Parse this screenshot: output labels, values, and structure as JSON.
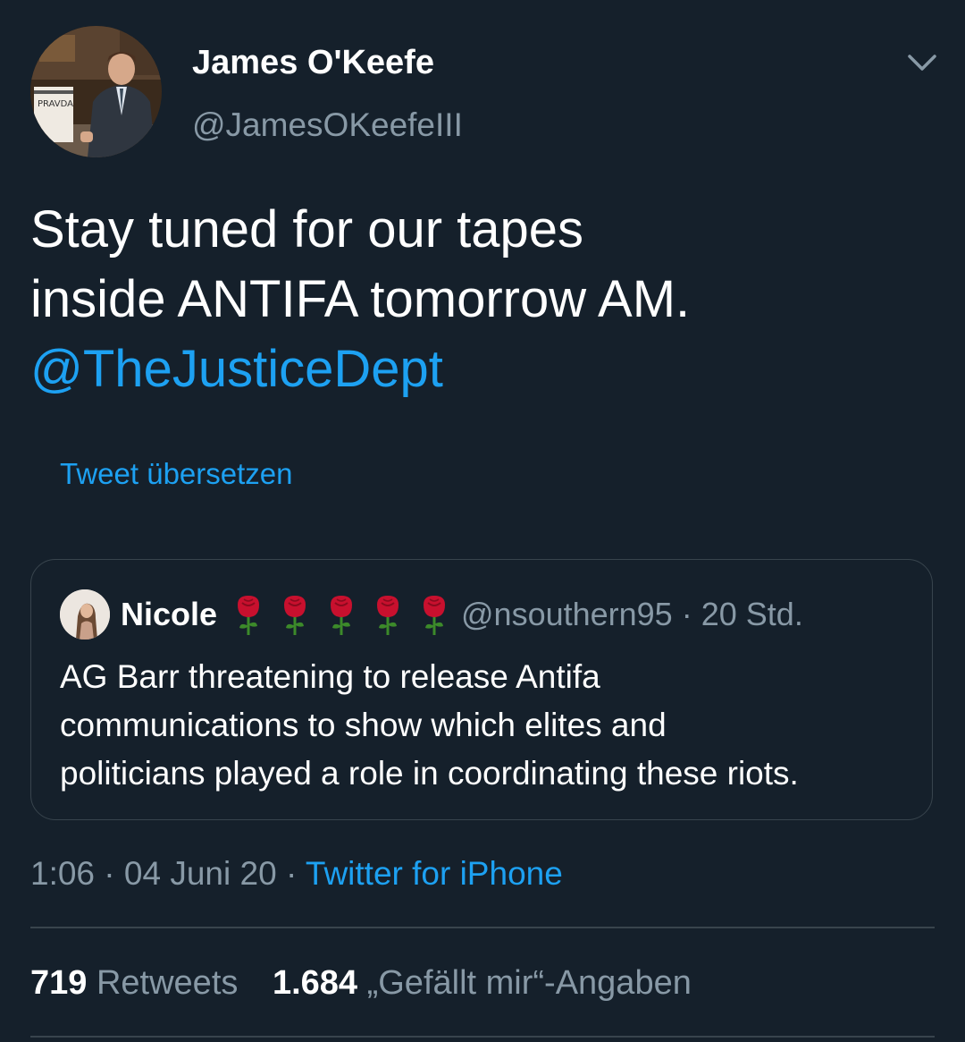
{
  "author": {
    "display_name": "James O'Keefe",
    "handle": "@JamesOKeefeIII",
    "avatar_sign_text": "PRAVDA"
  },
  "tweet": {
    "text_lines": [
      "Stay tuned for our tapes",
      "inside ANTIFA tomorrow AM."
    ],
    "mention": "@TheJusticeDept",
    "translate_label": "Tweet übersetzen"
  },
  "quoted_tweet": {
    "display_name": "Nicole",
    "emoji": [
      "rose",
      "rose",
      "rose",
      "rose",
      "rose"
    ],
    "handle": "@nsouthern95",
    "separator": "·",
    "age": "20 Std.",
    "text_lines": [
      "AG Barr threatening to release Antifa",
      "communications to show which elites and",
      "politicians played a role in coordinating these riots."
    ]
  },
  "meta": {
    "time": "1:06",
    "separator": "·",
    "date": "04 Juni 20",
    "source": "Twitter for iPhone"
  },
  "stats": {
    "retweets_count": "719",
    "retweets_label": "Retweets",
    "likes_count": "1.684",
    "likes_label": "„Gefällt mir“-Angaben"
  },
  "icons": {
    "menu": "chevron-down-icon",
    "emoji": "rose-icon"
  },
  "colors": {
    "background": "#15202b",
    "accent": "#1da1f2",
    "secondary_text": "#8899a6",
    "border": "#38444d"
  }
}
